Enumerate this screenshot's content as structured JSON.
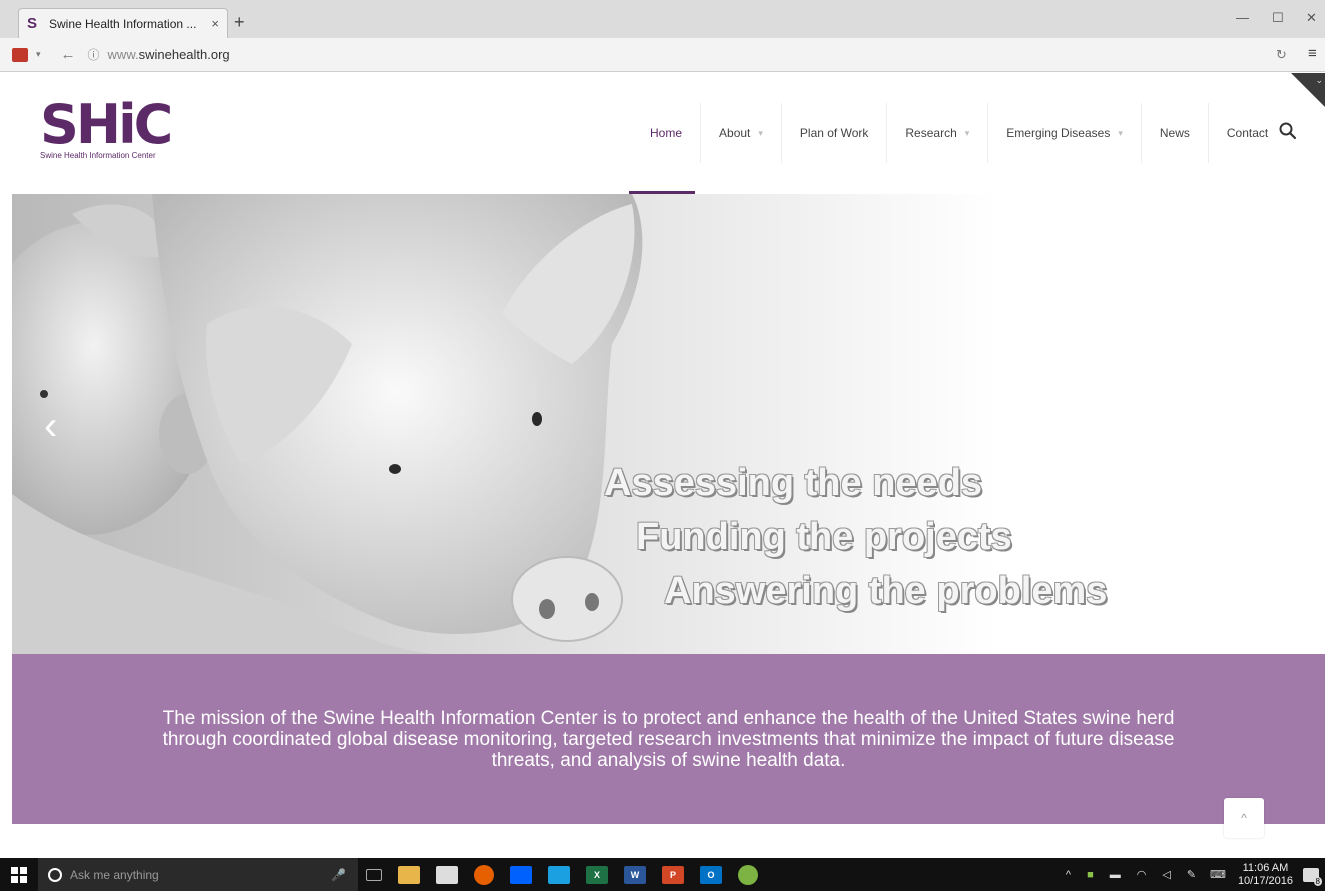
{
  "browser": {
    "tab_title": "Swine Health Information ...",
    "tab_close": "×",
    "new_tab": "+",
    "url_prefix": "www.",
    "url_domain": "swinehealth.org",
    "minimize": "—",
    "maximize": "☐",
    "close": "✕"
  },
  "site": {
    "logo_mark": "SHiC",
    "logo_sub": "Swine Health Information Center",
    "menu": [
      {
        "label": "Home",
        "has_caret": false,
        "active": true
      },
      {
        "label": "About",
        "has_caret": true
      },
      {
        "label": "Plan of Work",
        "has_caret": false
      },
      {
        "label": "Research",
        "has_caret": true
      },
      {
        "label": "Emerging Diseases",
        "has_caret": true
      },
      {
        "label": "News",
        "has_caret": false
      },
      {
        "label": "Contact",
        "has_caret": false
      }
    ]
  },
  "hero": {
    "prev_arrow": "‹",
    "lines": [
      "Assessing the needs",
      "Funding the projects",
      "Answering the problems"
    ]
  },
  "mission": {
    "text": "The mission of the Swine Health Information Center is to protect and enhance the health of the United States swine herd through coordinated global disease monitoring, targeted research investments that minimize the impact of future disease threats, and analysis of swine health data."
  },
  "back_to_top": "^",
  "taskbar": {
    "search_placeholder": "Ask me anything",
    "time": "11:06 AM",
    "date": "10/17/2016",
    "notifications": "8"
  },
  "colors": {
    "brand": "#5c2a67",
    "mission_bg": "#a17aa9"
  }
}
